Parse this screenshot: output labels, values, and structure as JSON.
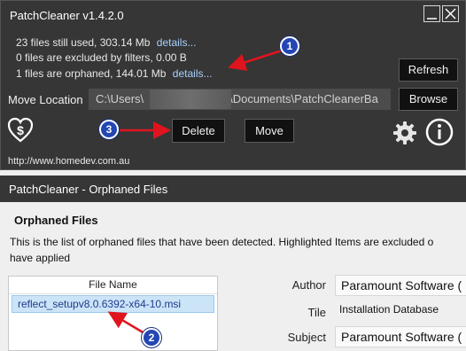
{
  "main_window": {
    "title": "PatchCleaner v1.4.2.0",
    "stats": [
      {
        "text": "23 files still used, 303.14 Mb",
        "link": "details..."
      },
      {
        "text": "0 files are excluded by filters, 0.00 B",
        "link": ""
      },
      {
        "text": "1 files are orphaned, 144.01 Mb",
        "link": "details..."
      }
    ],
    "refresh_label": "Refresh",
    "move_location_label": "Move Location",
    "path_prefix": "C:\\Users\\",
    "path_suffix": "\\Documents\\PatchCleanerBa",
    "browse_label": "Browse",
    "delete_label": "Delete",
    "move_label": "Move",
    "url": "http://www.homedev.com.au",
    "icons": [
      "heart-dollar-icon",
      "gear-icon",
      "info-icon"
    ]
  },
  "orphaned_window": {
    "title": "PatchCleaner - Orphaned Files",
    "heading": "Orphaned Files",
    "description_line1": "This is the list of orphaned files that have been detected. Highlighted Items are excluded o",
    "description_line2": "have applied",
    "list_header": "File Name",
    "files": [
      "reflect_setupv8.0.6392-x64-10.msi"
    ],
    "properties": {
      "author_label": "Author",
      "author_value": "Paramount Software (",
      "title_label": "Tile",
      "title_value": "Installation Database",
      "subject_label": "Subject",
      "subject_value": "Paramount Software ("
    }
  },
  "annotations": [
    "1",
    "2",
    "3"
  ],
  "colors": {
    "annotation_red": "#e0141e",
    "badge_blue": "#2446b4",
    "link_blue": "#a9d2ff"
  }
}
